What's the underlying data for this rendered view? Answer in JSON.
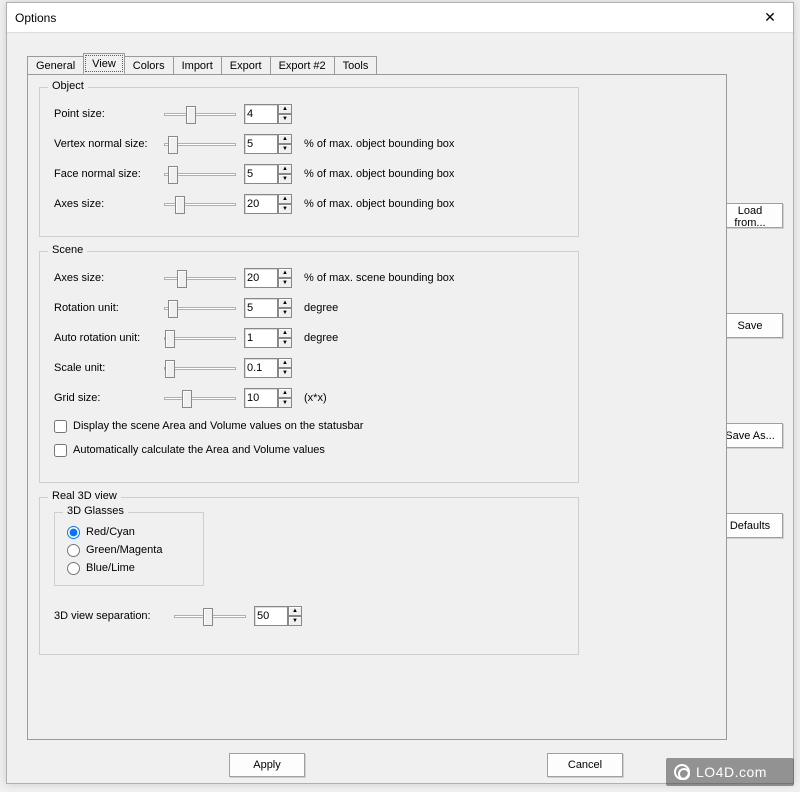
{
  "window": {
    "title": "Options"
  },
  "tabs": [
    {
      "label": "General"
    },
    {
      "label": "View"
    },
    {
      "label": "Colors"
    },
    {
      "label": "Import"
    },
    {
      "label": "Export"
    },
    {
      "label": "Export #2"
    },
    {
      "label": "Tools"
    }
  ],
  "active_tab_index": 1,
  "object_group": {
    "legend": "Object",
    "point_size": {
      "label": "Point size:",
      "value": "4",
      "unit": "",
      "thumb_pct": 30
    },
    "vertex_normal_size": {
      "label": "Vertex normal size:",
      "value": "5",
      "unit": "% of max. object bounding box",
      "thumb_pct": 5
    },
    "face_normal_size": {
      "label": "Face normal size:",
      "value": "5",
      "unit": "% of max. object bounding box",
      "thumb_pct": 5
    },
    "axes_size": {
      "label": "Axes size:",
      "value": "20",
      "unit": "% of max. object bounding box",
      "thumb_pct": 15
    }
  },
  "scene_group": {
    "legend": "Scene",
    "axes_size": {
      "label": "Axes size:",
      "value": "20",
      "unit": "% of max. scene bounding box",
      "thumb_pct": 18
    },
    "rotation_unit": {
      "label": "Rotation unit:",
      "value": "5",
      "unit": "degree",
      "thumb_pct": 5
    },
    "auto_rotation_unit": {
      "label": "Auto rotation unit:",
      "value": "1",
      "unit": "degree",
      "thumb_pct": 2
    },
    "scale_unit": {
      "label": "Scale unit:",
      "value": "0.1",
      "unit": "",
      "thumb_pct": 2
    },
    "grid_size": {
      "label": "Grid size:",
      "value": "10",
      "unit": "(x*x)",
      "thumb_pct": 25
    },
    "display_area_volume_label": "Display the scene Area and Volume values on the statusbar",
    "auto_calc_area_volume_label": "Automatically calculate the Area and Volume values"
  },
  "real3d_group": {
    "legend": "Real 3D view",
    "glasses_legend": "3D Glasses",
    "glasses_options": [
      {
        "label": "Red/Cyan",
        "checked": true
      },
      {
        "label": "Green/Magenta",
        "checked": false
      },
      {
        "label": "Blue/Lime",
        "checked": false
      }
    ],
    "separation": {
      "label": "3D view separation:",
      "value": "50",
      "thumb_pct": 40
    }
  },
  "side_buttons": {
    "load_from": "Load from...",
    "save": "Save",
    "save_as": "Save As...",
    "defaults": "Defaults"
  },
  "bottom_buttons": {
    "apply": "Apply",
    "cancel": "Cancel"
  },
  "watermark": "LO4D.com"
}
